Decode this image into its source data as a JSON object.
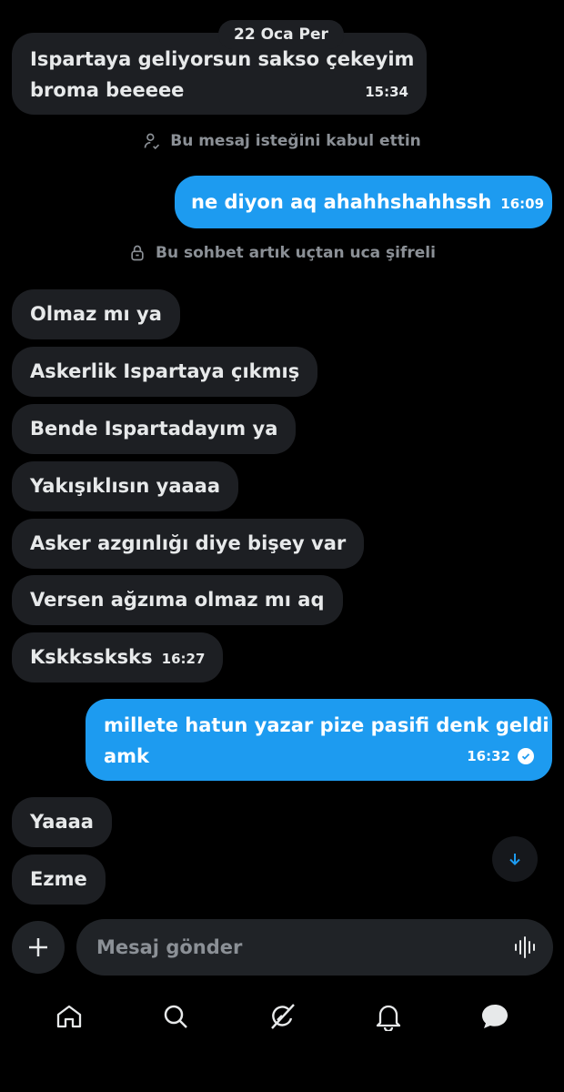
{
  "date_separator": "22 Oca Per",
  "messages": [
    {
      "lines": [
        "Ispartaya geliyorsun sakso çekeyim",
        "broma beeeee"
      ],
      "time": "15:34",
      "direction": "in"
    },
    {
      "text": "ne diyon aq ahahhshahhssh",
      "time": "16:09",
      "direction": "out"
    },
    {
      "text": "Olmaz mı ya",
      "direction": "in"
    },
    {
      "text": "Askerlik Ispartaya çıkmış",
      "direction": "in"
    },
    {
      "text": "Bende Ispartadayım ya",
      "direction": "in"
    },
    {
      "text": "Yakışıklısın yaaaa",
      "direction": "in"
    },
    {
      "text": "Asker azgınlığı diye bişey var",
      "direction": "in"
    },
    {
      "text": "Versen ağzıma olmaz mı aq",
      "direction": "in"
    },
    {
      "text": "Kskkssksks",
      "time": "16:27",
      "direction": "in"
    },
    {
      "lines": [
        "millete hatun yazar pize pasifi denk geldi",
        "amk"
      ],
      "time": "16:32",
      "direction": "out",
      "status": "read"
    },
    {
      "text": "Yaaaa",
      "direction": "in"
    },
    {
      "text": "Ezme",
      "direction": "in"
    }
  ],
  "system_notices": {
    "accepted": "Bu mesaj isteğini kabul ettin",
    "encrypted": "Bu sohbet artık uçtan uca şifreli"
  },
  "composer": {
    "placeholder": "Mesaj gönder"
  },
  "nav": [
    "home-icon",
    "search-icon",
    "grok-icon",
    "notifications-icon",
    "messages-icon"
  ],
  "colors": {
    "background": "#000000",
    "incoming_bubble": "#1d1f23",
    "outgoing_bubble": "#1d9bf0",
    "muted_text": "#8b9096"
  }
}
